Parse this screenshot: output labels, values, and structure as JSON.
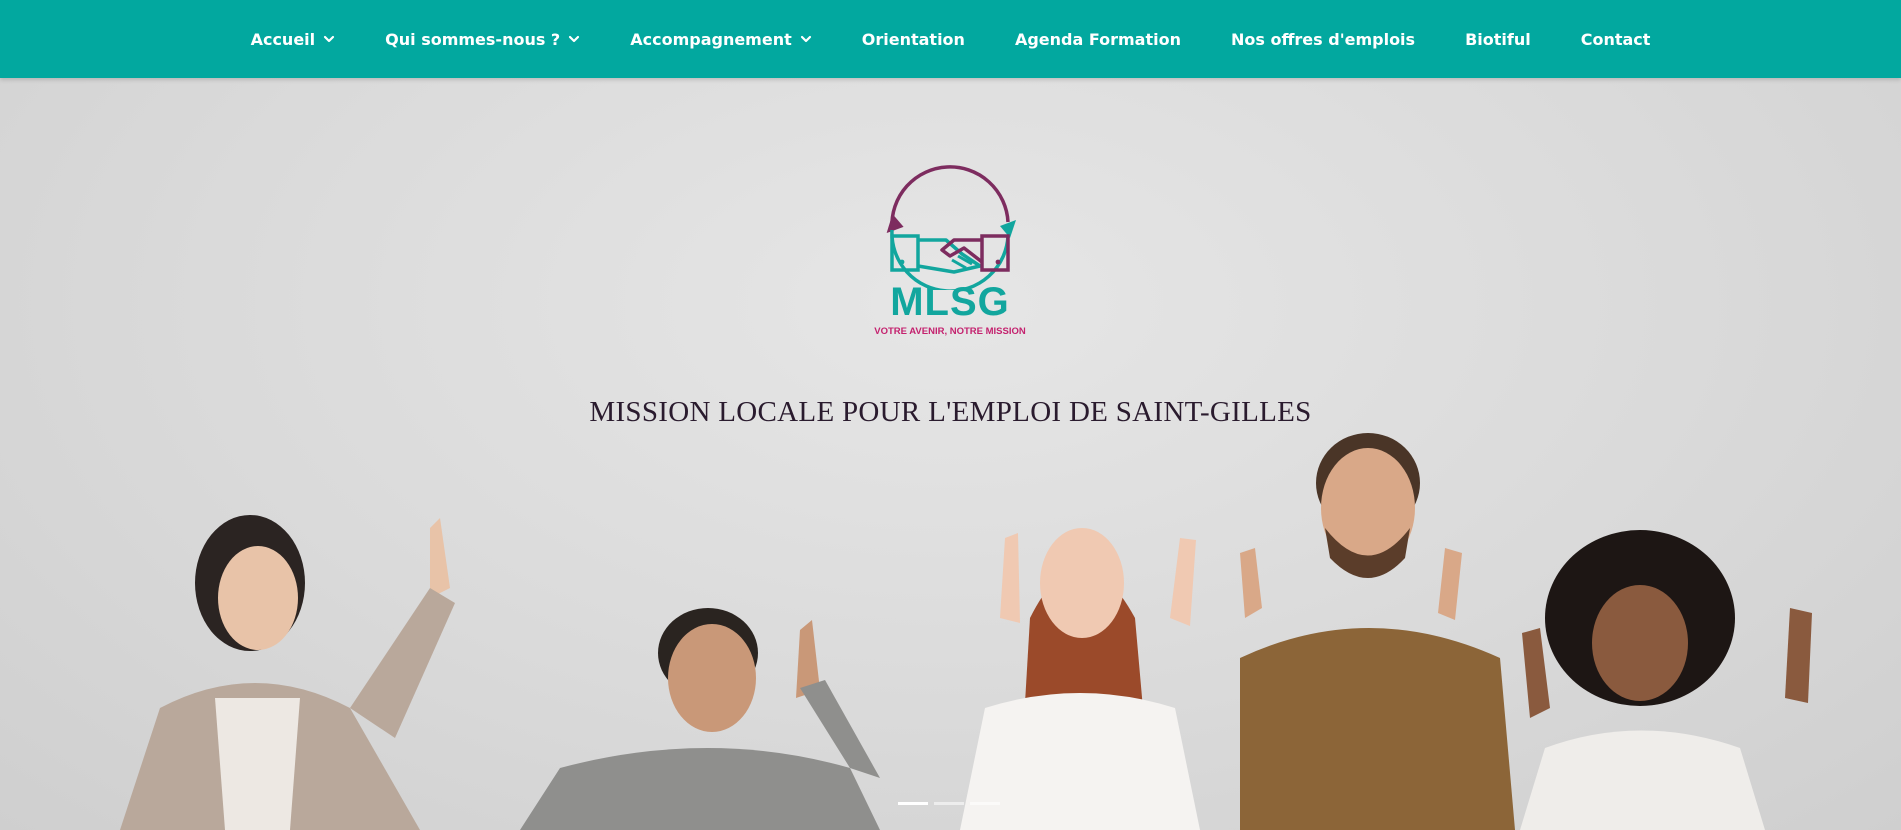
{
  "nav": {
    "items": [
      {
        "label": "Accueil",
        "has_dropdown": true
      },
      {
        "label": "Qui sommes-nous ?",
        "has_dropdown": true
      },
      {
        "label": "Accompagnement",
        "has_dropdown": true
      },
      {
        "label": "Orientation",
        "has_dropdown": false
      },
      {
        "label": "Agenda Formation",
        "has_dropdown": false
      },
      {
        "label": "Nos offres d'emplois",
        "has_dropdown": false
      },
      {
        "label": "Biotiful",
        "has_dropdown": false
      },
      {
        "label": "Contact",
        "has_dropdown": false
      }
    ]
  },
  "logo": {
    "word": "MLSG",
    "tagline": "VOTRE AVENIR, NOTRE MISSION"
  },
  "hero": {
    "title": "MISSION LOCALE POUR L'EMPLOI DE SAINT-GILLES"
  },
  "carousel": {
    "slides": 3,
    "active": 1
  },
  "colors": {
    "nav_bg": "#02a89f",
    "brand_teal": "#12a69e",
    "brand_purple": "#7d2c5f",
    "brand_pink": "#c4216e"
  }
}
